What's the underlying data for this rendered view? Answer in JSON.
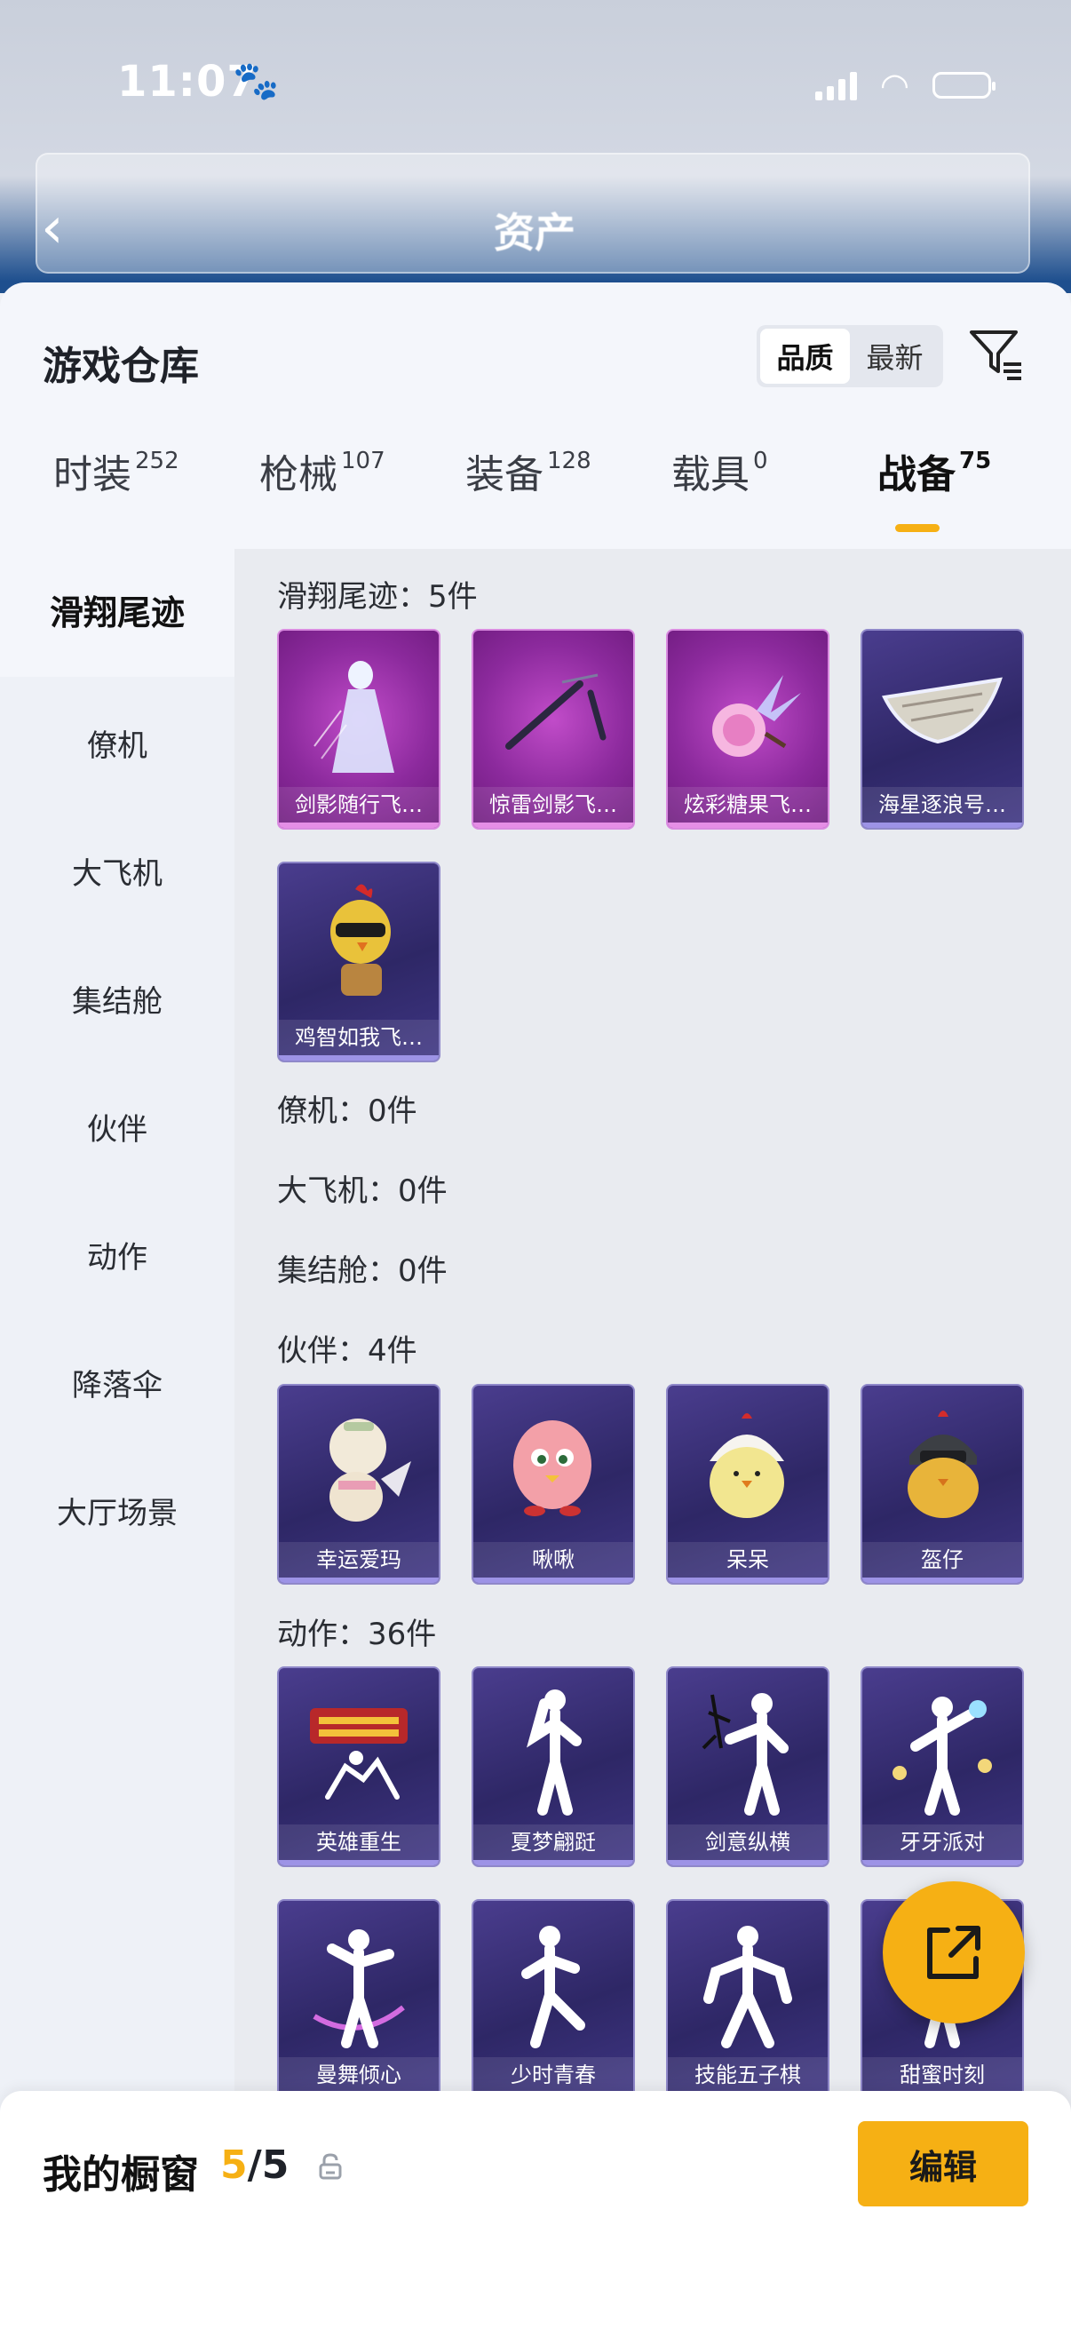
{
  "status_bar": {
    "time": "11:07"
  },
  "header": {
    "title": "资产"
  },
  "sheet": {
    "title": "游戏仓库",
    "sort_options": [
      "品质",
      "最新"
    ],
    "tabs": [
      {
        "label": "时装",
        "count": "252"
      },
      {
        "label": "枪械",
        "count": "107"
      },
      {
        "label": "装备",
        "count": "128"
      },
      {
        "label": "载具",
        "count": "0"
      },
      {
        "label": "战备",
        "count": "75"
      }
    ]
  },
  "sidebar": {
    "items": [
      "滑翔尾迹",
      "僚机",
      "大飞机",
      "集结舱",
      "伙伴",
      "动作",
      "降落伞",
      "大厅场景"
    ]
  },
  "sections": {
    "glide": {
      "label": "滑翔尾迹：5件",
      "items": [
        "剑影随行飞…",
        "惊雷剑影飞…",
        "炫彩糖果飞…",
        "海星逐浪号…",
        "鸡智如我飞…"
      ]
    },
    "wingman": {
      "label": "僚机：0件"
    },
    "plane": {
      "label": "大飞机：0件"
    },
    "pod": {
      "label": "集结舱：0件"
    },
    "partner": {
      "label": "伙伴：4件",
      "items": [
        "幸运爱玛",
        "啾啾",
        "呆呆",
        "盔仔"
      ]
    },
    "emote": {
      "label": "动作：36件",
      "items": [
        "英雄重生",
        "夏梦翩跹",
        "剑意纵横",
        "牙牙派对",
        "曼舞倾心",
        "少时青春",
        "技能五子棋",
        "甜蜜时刻"
      ]
    }
  },
  "bottom": {
    "label": "我的橱窗",
    "current": "5",
    "total": "/5",
    "edit_label": "编辑"
  },
  "colors": {
    "accent": "#f6b014",
    "card_purple": "#2e2766",
    "card_pink": "#8c2a9d"
  }
}
